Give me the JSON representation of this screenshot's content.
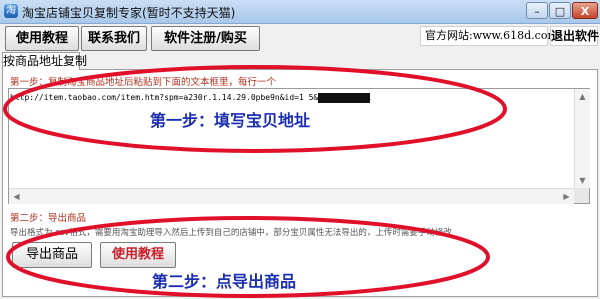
{
  "window": {
    "title": "淘宝店铺宝贝复制专家(暂时不支持天猫)",
    "controls": {
      "minimize": "–",
      "maximize": "□",
      "close": "X"
    }
  },
  "toolbar": {
    "help_label": "使用教程",
    "contact_label": "联系我们",
    "register_label": "软件注册/购买",
    "website_text": "官方网站:www.618d.com",
    "exit_label": "退出软件"
  },
  "tabs": [
    {
      "label": "按商品地址复制",
      "selected": true
    }
  ],
  "step1": {
    "label": "第一步：复制淘宝商品地址后粘贴到下面的文本框里，每行一个",
    "url_value": "http://item.taobao.com/item.htm?spm=a230r.1.14.29.0pbe9n&id=1              5&ns=1#detail"
  },
  "step2": {
    "label": "第二步：导出商品",
    "description": "导出格式为 csv格式，需要用淘宝助理导入然后上传到自己的店铺中，部分宝贝属性无法导出的，上传时需要手动修改",
    "export_label": "导出商品",
    "help_label": "使用教程"
  },
  "annotations": [
    {
      "text": "第一步：填写宝贝地址"
    },
    {
      "text": "第二步：点导出商品"
    }
  ],
  "colors": {
    "annotation_outline": "#e0102a",
    "annotation_text": "#1b2fb0",
    "step_label": "#b03020"
  },
  "icons": {
    "app": "app-logo-icon",
    "scroll_up": "arrow-up-icon",
    "scroll_down": "arrow-down-icon",
    "scroll_left": "arrow-left-icon",
    "scroll_right": "arrow-right-icon"
  }
}
